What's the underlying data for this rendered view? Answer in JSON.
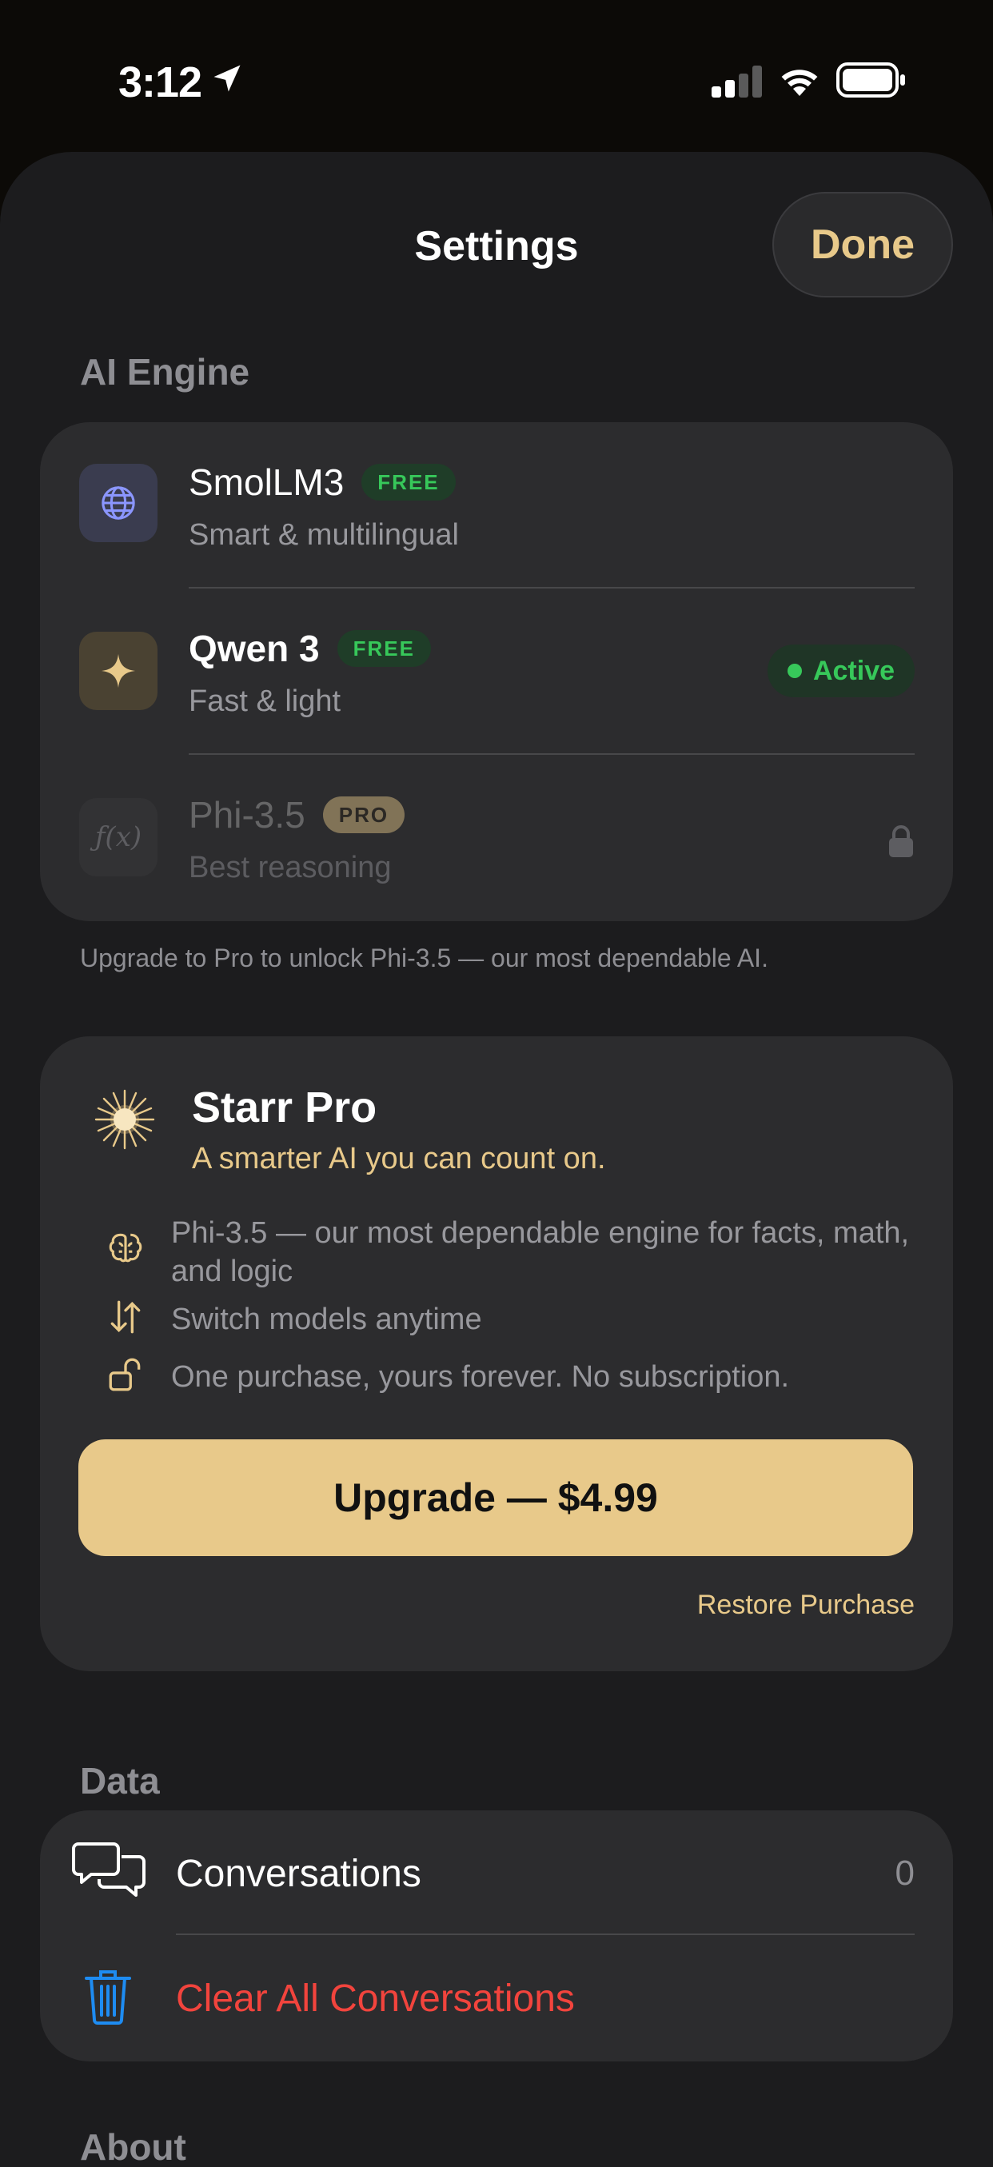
{
  "status_bar": {
    "time": "3:12",
    "icons": [
      "location-arrow-icon",
      "cellular-signal-icon",
      "wifi-icon",
      "battery-icon"
    ]
  },
  "nav": {
    "title": "Settings",
    "done_label": "Done"
  },
  "ai_engine": {
    "section_label": "AI Engine",
    "models": [
      {
        "name": "SmolLM3",
        "badge": "FREE",
        "subtitle": "Smart & multilingual",
        "icon": "globe-icon"
      },
      {
        "name": "Qwen 3",
        "badge": "FREE",
        "subtitle": "Fast & light",
        "icon": "sparkle-icon",
        "status": "Active"
      },
      {
        "name": "Phi-3.5",
        "badge": "PRO",
        "subtitle": "Best reasoning",
        "icon": "function-icon",
        "locked": true
      }
    ],
    "note": "Upgrade to Pro to unlock Phi-3.5 — our most dependable AI."
  },
  "pro": {
    "title": "Starr Pro",
    "subtitle": "A smarter AI you can count on.",
    "features": [
      {
        "icon": "brain-icon",
        "text": "Phi-3.5 — our most dependable engine for facts, math, and logic"
      },
      {
        "icon": "switch-arrows-icon",
        "text": "Switch models anytime"
      },
      {
        "icon": "unlock-icon",
        "text": "One purchase, yours forever. No subscription."
      }
    ],
    "upgrade_label": "Upgrade — $4.99",
    "restore_label": "Restore Purchase"
  },
  "data": {
    "section_label": "Data",
    "conversations_label": "Conversations",
    "conversations_count": "0",
    "clear_label": "Clear All Conversations"
  },
  "about": {
    "section_label": "About"
  },
  "colors": {
    "accent_gold": "#e8c98a",
    "active_green": "#37c85a",
    "danger_red": "#f2443d",
    "trash_blue": "#1e8cf2",
    "card_bg": "#2c2c2e",
    "sheet_bg": "#1c1c1e"
  }
}
